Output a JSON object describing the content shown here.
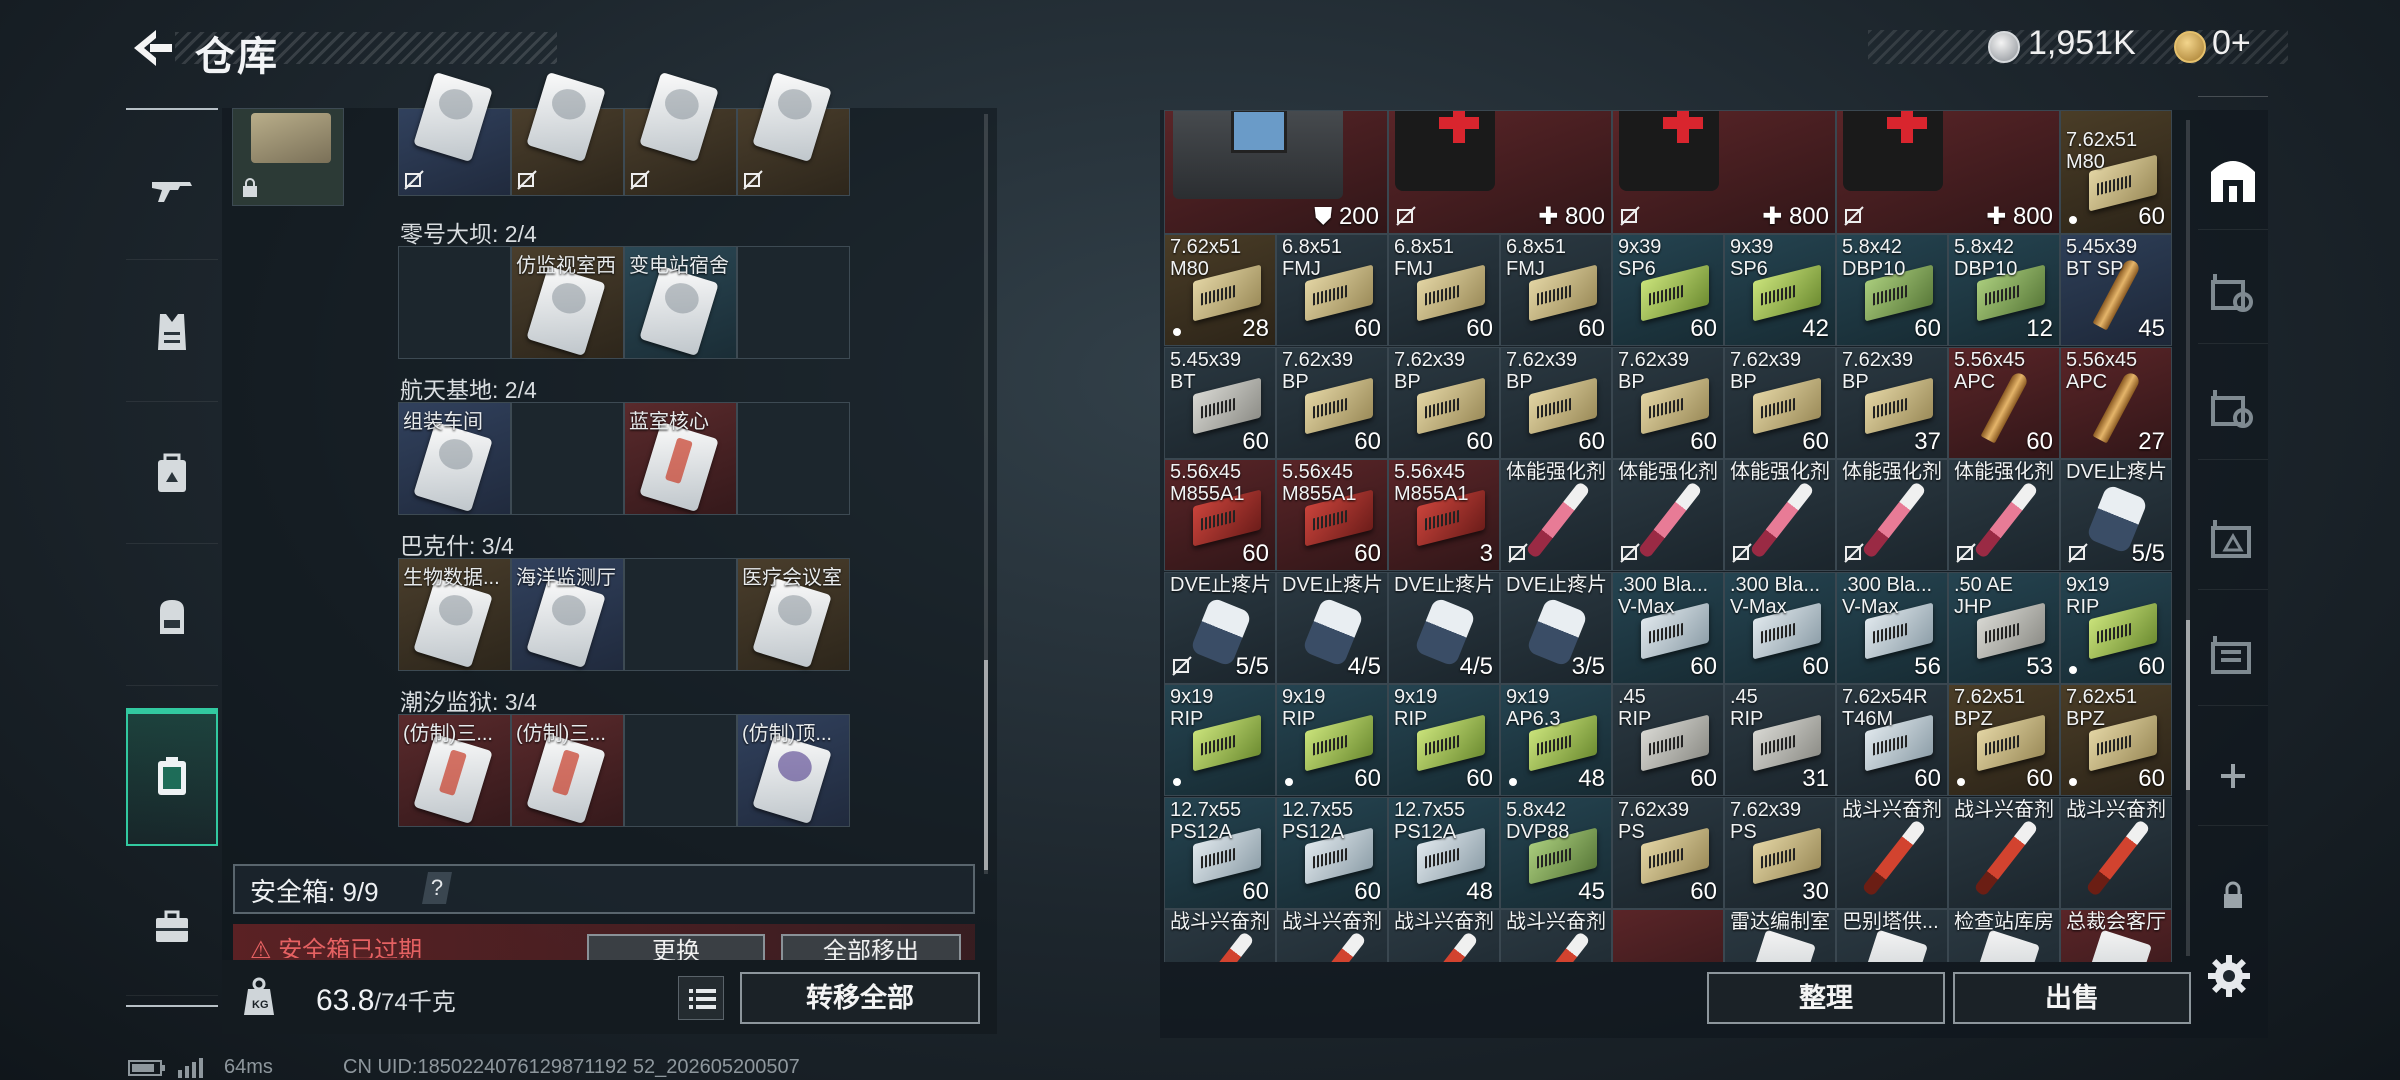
{
  "header": {
    "title": "仓库",
    "silver_value": "1,951K",
    "gold_value": "0+"
  },
  "left_nav": [
    "rifle-icon",
    "vest-icon",
    "backpack-case-icon",
    "backpack-icon",
    "keycard-case-icon",
    "toolbox-icon"
  ],
  "card_groups": [
    {
      "name": "零号大坝: 2/4",
      "slots": [
        {
          "label": "",
          "color": "empty"
        },
        {
          "label": "仿监视室西",
          "color": "gold"
        },
        {
          "label": "变电站宿舍",
          "color": "teal"
        },
        {
          "label": "",
          "color": "empty"
        }
      ]
    },
    {
      "name": "航天基地: 2/4",
      "slots": [
        {
          "label": "组装车间",
          "color": "blue"
        },
        {
          "label": "",
          "color": "empty"
        },
        {
          "label": "蓝室核心",
          "color": "red"
        },
        {
          "label": "",
          "color": "empty"
        }
      ]
    },
    {
      "name": "巴克什: 3/4",
      "slots": [
        {
          "label": "生物数据...",
          "color": "gold"
        },
        {
          "label": "海洋监测厅",
          "color": "blue"
        },
        {
          "label": "",
          "color": "empty"
        },
        {
          "label": "医疗会议室",
          "color": "gold"
        }
      ]
    },
    {
      "name": "潮汐监狱: 3/4",
      "slots": [
        {
          "label": "(仿制)三...",
          "color": "red"
        },
        {
          "label": "(仿制)三...",
          "color": "red"
        },
        {
          "label": "",
          "color": "empty"
        },
        {
          "label": "(仿制)顶...",
          "color": "blue"
        }
      ]
    }
  ],
  "safe_box": {
    "label": "安全箱: 9/9",
    "help": "?",
    "warning": "安全箱已过期",
    "replace": "更换",
    "move_out_all": "全部移出"
  },
  "weight": {
    "current": "63.8",
    "max": "/74千克"
  },
  "transfer_all": "转移全部",
  "status": {
    "ping": "64ms",
    "uid": "CN UID:1850224076129871192 52_202605200507"
  },
  "top_row": [
    {
      "value": "200",
      "kind": "armor"
    },
    {
      "value": "800",
      "kind": "heal"
    },
    {
      "value": "800",
      "kind": "heal"
    },
    {
      "value": "800",
      "kind": "heal"
    },
    {
      "name": "7.62x51\nM80",
      "qty": "60"
    }
  ],
  "grid_items": [
    {
      "name": "7.62x51\nM80",
      "qty": "28",
      "dot": true,
      "c": "c-gold",
      "art": "b-tan"
    },
    {
      "name": "6.8x51\nFMJ",
      "qty": "60",
      "c": "",
      "art": "b-tan"
    },
    {
      "name": "6.8x51\nFMJ",
      "qty": "60",
      "c": "",
      "art": "b-tan"
    },
    {
      "name": "6.8x51\nFMJ",
      "qty": "60",
      "c": "",
      "art": "b-tan"
    },
    {
      "name": "9x39\nSP6",
      "qty": "60",
      "c": "c-teal",
      "art": "b-green"
    },
    {
      "name": "9x39\nSP6",
      "qty": "42",
      "c": "c-teal",
      "art": "b-green"
    },
    {
      "name": "5.8x42\nDBP10",
      "qty": "60",
      "c": "c-teal",
      "art": "b-mgreen"
    },
    {
      "name": "5.8x42\nDBP10",
      "qty": "12",
      "c": "c-teal",
      "art": "b-mgreen"
    },
    {
      "name": "5.45x39\nBT SP",
      "qty": "45",
      "c": "c-blue",
      "art": "bullet"
    },
    {
      "name": "5.45x39\nBT",
      "qty": "60",
      "c": "",
      "art": "b-grey"
    },
    {
      "name": "7.62x39\nBP",
      "qty": "60",
      "c": "",
      "art": "b-tan"
    },
    {
      "name": "7.62x39\nBP",
      "qty": "60",
      "c": "",
      "art": "b-tan"
    },
    {
      "name": "7.62x39\nBP",
      "qty": "60",
      "c": "",
      "art": "b-tan"
    },
    {
      "name": "7.62x39\nBP",
      "qty": "60",
      "c": "",
      "art": "b-tan"
    },
    {
      "name": "7.62x39\nBP",
      "qty": "60",
      "c": "",
      "art": "b-tan"
    },
    {
      "name": "7.62x39\nBP",
      "qty": "37",
      "c": "",
      "art": "b-tan"
    },
    {
      "name": "5.56x45\nAPC",
      "qty": "60",
      "c": "c-red",
      "art": "bullet"
    },
    {
      "name": "5.56x45\nAPC",
      "qty": "27",
      "c": "c-red",
      "art": "bullet"
    },
    {
      "name": "5.56x45\nM855A1",
      "qty": "60",
      "c": "c-red",
      "art": "b-redbox"
    },
    {
      "name": "5.56x45\nM855A1",
      "qty": "60",
      "c": "c-red",
      "art": "b-redbox"
    },
    {
      "name": "5.56x45\nM855A1",
      "qty": "3",
      "c": "c-red",
      "art": "b-redbox"
    },
    {
      "name": "体能强化剂",
      "qty": "",
      "nl": true,
      "c": "",
      "art": "syringe pink"
    },
    {
      "name": "体能强化剂",
      "qty": "",
      "nl": true,
      "c": "",
      "art": "syringe pink"
    },
    {
      "name": "体能强化剂",
      "qty": "",
      "nl": true,
      "c": "",
      "art": "syringe pink"
    },
    {
      "name": "体能强化剂",
      "qty": "",
      "nl": true,
      "c": "",
      "art": "syringe pink"
    },
    {
      "name": "体能强化剂",
      "qty": "",
      "nl": true,
      "c": "",
      "art": "syringe pink"
    },
    {
      "name": "DVE止疼片",
      "qty": "5/5",
      "nl": true,
      "c": "",
      "art": "pill"
    },
    {
      "name": "DVE止疼片",
      "qty": "5/5",
      "nl": true,
      "c": "",
      "art": "pill"
    },
    {
      "name": "DVE止疼片",
      "qty": "4/5",
      "c": "",
      "art": "pill"
    },
    {
      "name": "DVE止疼片",
      "qty": "4/5",
      "c": "",
      "art": "pill"
    },
    {
      "name": "DVE止疼片",
      "qty": "3/5",
      "c": "",
      "art": "pill"
    },
    {
      "name": ".300 Bla...\nV-Max",
      "qty": "60",
      "c": "c-teal",
      "art": "b-silver"
    },
    {
      "name": ".300 Bla...\nV-Max",
      "qty": "60",
      "c": "c-teal",
      "art": "b-silver"
    },
    {
      "name": ".300 Bla...\nV-Max",
      "qty": "56",
      "c": "c-teal",
      "art": "b-silver"
    },
    {
      "name": ".50 AE\nJHP",
      "qty": "53",
      "c": "c-teal",
      "art": "b-grey"
    },
    {
      "name": "9x19\nRIP",
      "qty": "60",
      "dot": true,
      "c": "c-teal",
      "art": "b-green"
    },
    {
      "name": "9x19\nRIP",
      "qty": "",
      "dot": true,
      "c": "c-teal",
      "art": "b-green"
    },
    {
      "name": "9x19\nRIP",
      "qty": "60",
      "dot": true,
      "c": "c-teal",
      "art": "b-green"
    },
    {
      "name": "9x19\nRIP",
      "qty": "60",
      "c": "c-teal",
      "art": "b-green"
    },
    {
      "name": "9x19\nAP6.3",
      "qty": "48",
      "dot": true,
      "c": "c-teal",
      "art": "b-green"
    },
    {
      "name": ".45\nRIP",
      "qty": "60",
      "c": "",
      "art": "b-grey"
    },
    {
      "name": ".45\nRIP",
      "qty": "31",
      "c": "",
      "art": "b-grey"
    },
    {
      "name": "7.62x54R\nT46M",
      "qty": "60",
      "c": "",
      "art": "b-silver"
    },
    {
      "name": "7.62x51\nBPZ",
      "qty": "60",
      "dot": true,
      "c": "c-gold",
      "art": "b-tan"
    },
    {
      "name": "7.62x51\nBPZ",
      "qty": "60",
      "dot": true,
      "c": "c-gold",
      "art": "b-tan"
    },
    {
      "name": "12.7x55\nPS12A",
      "qty": "60",
      "c": "c-teal",
      "art": "b-silver"
    },
    {
      "name": "12.7x55\nPS12A",
      "qty": "60",
      "c": "c-teal",
      "art": "b-silver"
    },
    {
      "name": "12.7x55\nPS12A",
      "qty": "48",
      "c": "c-teal",
      "art": "b-silver"
    },
    {
      "name": "5.8x42\nDVP88",
      "qty": "45",
      "c": "c-teal",
      "art": "b-mgreen"
    },
    {
      "name": "7.62x39\nPS",
      "qty": "60",
      "c": "",
      "art": "b-tan"
    },
    {
      "name": "7.62x39\nPS",
      "qty": "30",
      "c": "",
      "art": "b-tan"
    },
    {
      "name": "战斗兴奋剂",
      "qty": "",
      "c": "",
      "art": "syringe red"
    },
    {
      "name": "战斗兴奋剂",
      "qty": "",
      "c": "",
      "art": "syringe red"
    },
    {
      "name": "战斗兴奋剂",
      "qty": "",
      "c": "",
      "art": "syringe red"
    },
    {
      "name": "战斗兴奋剂",
      "qty": "",
      "c": "",
      "art": "syringe red"
    },
    {
      "name": "战斗兴奋剂",
      "qty": "",
      "c": "",
      "art": "syringe red"
    },
    {
      "name": "战斗兴奋剂",
      "qty": "",
      "c": "",
      "art": "syringe red"
    },
    {
      "name": "战斗兴奋剂",
      "qty": "",
      "c": "",
      "art": "syringe red"
    },
    {
      "name": "",
      "qty": "",
      "c": "c-red",
      "art": ""
    },
    {
      "name": "雷达编制室",
      "qty": "",
      "c": "",
      "art": "rcard"
    },
    {
      "name": "巴别塔供...",
      "qty": "",
      "c": "",
      "art": "rcard"
    },
    {
      "name": "检查站库房",
      "qty": "",
      "c": "",
      "art": "rcard"
    },
    {
      "name": "总裁会客厅",
      "qty": "",
      "c": "c-red",
      "art": "rcard"
    }
  ],
  "right_nav": [
    "warehouse-icon",
    "container-search-icon-1",
    "container-search-icon-2",
    "container-search-icon-3",
    "container-search-icon-4",
    "add-icon",
    "lock-icon"
  ],
  "actions": {
    "sort": "整理",
    "sell": "出售"
  },
  "colors": {
    "accent": "#32c9a0",
    "warning": "#ff6d6d"
  }
}
